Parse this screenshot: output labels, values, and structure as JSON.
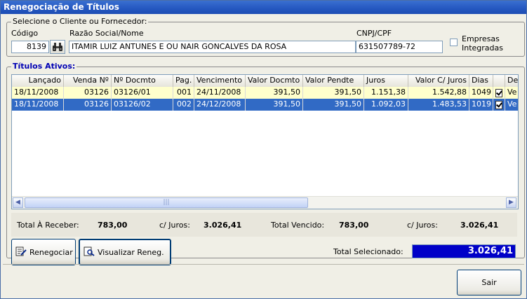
{
  "window": {
    "title": "Renegociação de Títulos"
  },
  "client_group": {
    "legend": "Selecione o Cliente ou Fornecedor:",
    "code_label": "Código",
    "code_value": "8139",
    "name_label": "Razão Social/Nome",
    "name_value": "ITAMIR LUIZ ANTUNES E OU NAIR GONCALVES DA ROSA",
    "doc_label": "CNPJ/CPF",
    "doc_value": "631507789-72",
    "companies_label_1": "Empresas",
    "companies_label_2": "Integradas"
  },
  "titles_group": {
    "legend": "Títulos Ativos:",
    "columns": [
      "Lançado",
      "Venda Nº",
      "Nº Docmto",
      "Pag.",
      "Vencimento",
      "Valor Docmto",
      "Valor Pendte",
      "Juros",
      "Valor C/ Juros",
      "Dias",
      "",
      "De"
    ],
    "rows": [
      [
        "18/11/2008",
        "03126",
        "03126/01",
        "001",
        "24/11/2008",
        "391,50",
        "391,50",
        "1.151,38",
        "1.542,88",
        "1049",
        "",
        "Ve"
      ],
      [
        "18/11/2008",
        "03126",
        "03126/02",
        "002",
        "24/12/2008",
        "391,50",
        "391,50",
        "1.092,03",
        "1.483,53",
        "1019",
        "",
        "Ve"
      ]
    ],
    "scroll_thumb_glyph": "|||"
  },
  "summary": {
    "total_receber_label": "Total À Receber:",
    "total_receber_value": "783,00",
    "juros1_label": "c/ Juros:",
    "juros1_value": "3.026,41",
    "total_vencido_label": "Total Vencido:",
    "total_vencido_value": "783,00",
    "juros2_label": "c/ Juros:",
    "juros2_value": "3.026,41"
  },
  "actions": {
    "renegociar_label": "Renegociar",
    "visualizar_label": "Visualizar Reneg.",
    "total_selecionado_label": "Total Selecionado:",
    "total_selecionado_value": "3.026,41",
    "sair_label": "Sair"
  },
  "colors": {
    "title_bar": "#2457c0",
    "selected_row": "#316ac5",
    "highlight_row": "#ffffcc",
    "total_box": "#0000c8"
  }
}
